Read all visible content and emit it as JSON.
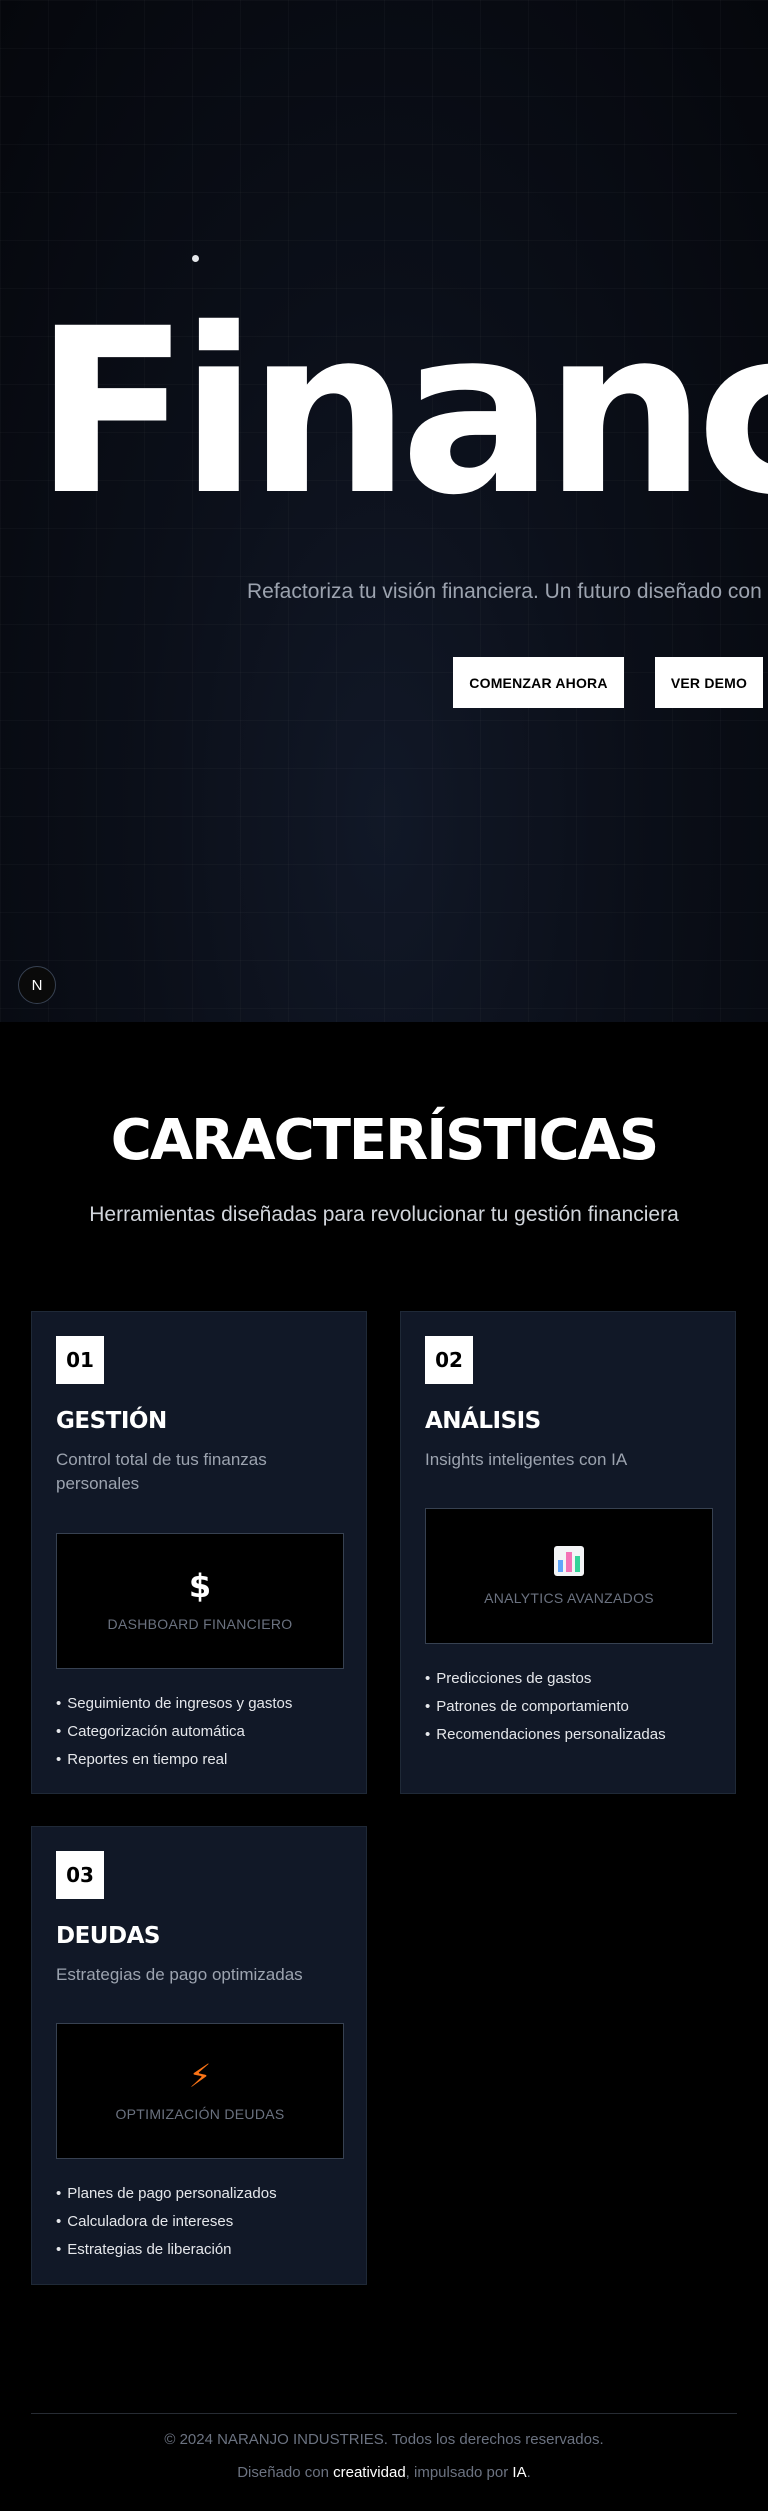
{
  "hero": {
    "title": "Financ",
    "subtitle": "Refactoriza tu visión financiera. Un futuro diseñado con",
    "buttons": {
      "start": "COMENZAR AHORA",
      "demo": "VER DEMO"
    },
    "badge": "N"
  },
  "features": {
    "title": "CARACTERÍSTICAS",
    "subtitle": "Herramientas diseñadas para revolucionar tu gestión financiera",
    "cards": [
      {
        "number": "01",
        "title": "GESTIÓN",
        "description": "Control total de tus finanzas personales",
        "preview_icon": "$",
        "preview_icon_name": "dollar-icon",
        "preview_label": "DASHBOARD FINANCIERO",
        "items": [
          "Seguimiento de ingresos y gastos",
          "Categorización automática",
          "Reportes en tiempo real"
        ]
      },
      {
        "number": "02",
        "title": "ANÁLISIS",
        "description": "Insights inteligentes con IA",
        "preview_icon": "",
        "preview_icon_name": "bar-chart-icon",
        "preview_label": "ANALYTICS AVANZADOS",
        "items": [
          "Predicciones de gastos",
          "Patrones de comportamiento",
          "Recomendaciones personalizadas"
        ]
      },
      {
        "number": "03",
        "title": "DEUDAS",
        "description": "Estrategias de pago optimizadas",
        "preview_icon": "⚡",
        "preview_icon_name": "lightning-icon",
        "preview_label": "OPTIMIZACIÓN DEUDAS",
        "items": [
          "Planes de pago personalizados",
          "Calculadora de intereses",
          "Estrategias de liberación"
        ]
      }
    ]
  },
  "footer": {
    "copyright": "© 2024 NARANJO INDUSTRIES. Todos los derechos reservados.",
    "made_prefix": "Diseñado con ",
    "made_word1": "creatividad",
    "made_middle": ", impulsado por ",
    "made_word2": "IA",
    "made_suffix": "."
  },
  "colors": {
    "background": "#000000",
    "card": "#111827",
    "accent_lightning": "#f97316"
  }
}
